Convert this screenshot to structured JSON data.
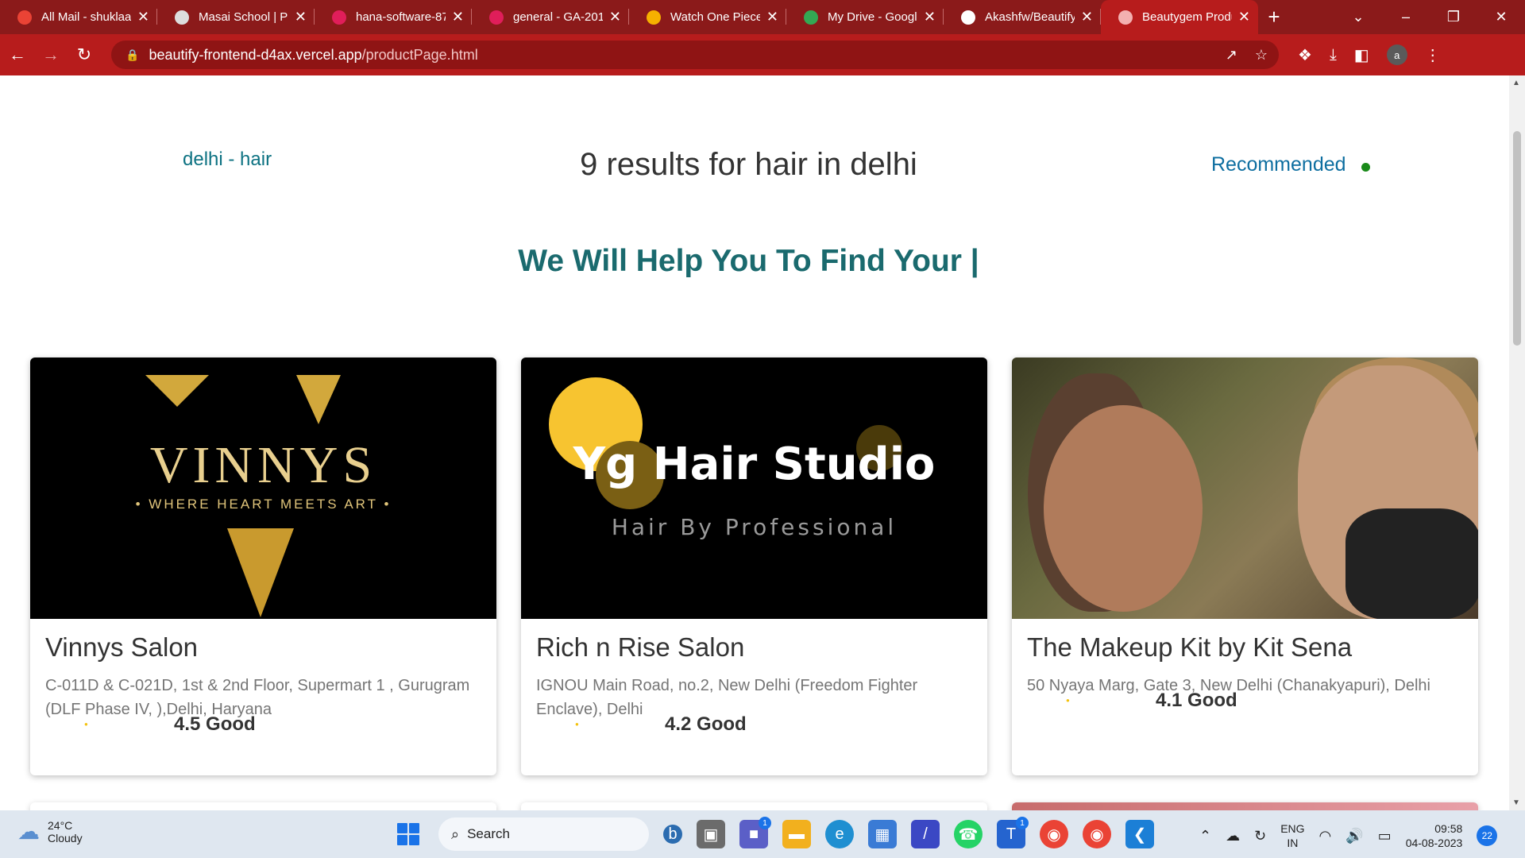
{
  "browser": {
    "tabs": [
      {
        "title": "All Mail - shuklaa",
        "icon": "gmail-icon",
        "color": "#ea4335",
        "active": false
      },
      {
        "title": "Masai School | Pla",
        "icon": "globe-icon",
        "color": "#dddddd",
        "active": false
      },
      {
        "title": "hana-software-87",
        "icon": "slack-icon",
        "color": "#e01e5a",
        "active": false
      },
      {
        "title": "general - GA-201",
        "icon": "slack-icon",
        "color": "#e01e5a",
        "active": false
      },
      {
        "title": "Watch One Piece",
        "icon": "crunchyroll-icon",
        "color": "#f6b000",
        "active": false
      },
      {
        "title": "My Drive - Googl",
        "icon": "google-drive-icon",
        "color": "#34a853",
        "active": false
      },
      {
        "title": "Akashfw/Beautify",
        "icon": "github-icon",
        "color": "#ffffff",
        "active": false
      },
      {
        "title": "Beautygem Produ",
        "icon": "globe-icon",
        "color": "#f3b0b0",
        "active": true
      }
    ],
    "url_host": "beautify-frontend-d4ax.vercel.app",
    "url_path": "/productPage.html",
    "profile_initial": "a"
  },
  "page": {
    "breadcrumb": "delhi - hair",
    "results_title": "9 results for hair in delhi",
    "sort_label": "Recommended",
    "tagline": "We Will Help You To Find Your |"
  },
  "cards": [
    {
      "name": "Vinnys Salon",
      "address": "C-011D & C-021D, 1st & 2nd Floor, Supermart 1 , Gurugram (DLF Phase IV, ),Delhi, Haryana",
      "rating": "4.5 Good",
      "logo_word": "VINNYS",
      "logo_sub": "• WHERE HEART MEETS ART •"
    },
    {
      "name": "Rich n Rise Salon",
      "address": "IGNOU Main Road, no.2, New Delhi (Freedom Fighter Enclave), Delhi",
      "rating": "4.2 Good",
      "logo_word": "Yg Hair Studio",
      "logo_sub": "Hair By Professional"
    },
    {
      "name": "The Makeup Kit by Kit Sena",
      "address": "50 Nyaya Marg, Gate 3, New Delhi (Chanakyapuri), Delhi",
      "rating": "4.1 Good"
    }
  ],
  "taskbar": {
    "weather_temp": "24°C",
    "weather_cond": "Cloudy",
    "search_label": "Search",
    "teams_badge": "1",
    "todo_badge": "1",
    "lang_line1": "ENG",
    "lang_line2": "IN",
    "time": "09:58",
    "date": "04-08-2023",
    "notifications": "22"
  }
}
